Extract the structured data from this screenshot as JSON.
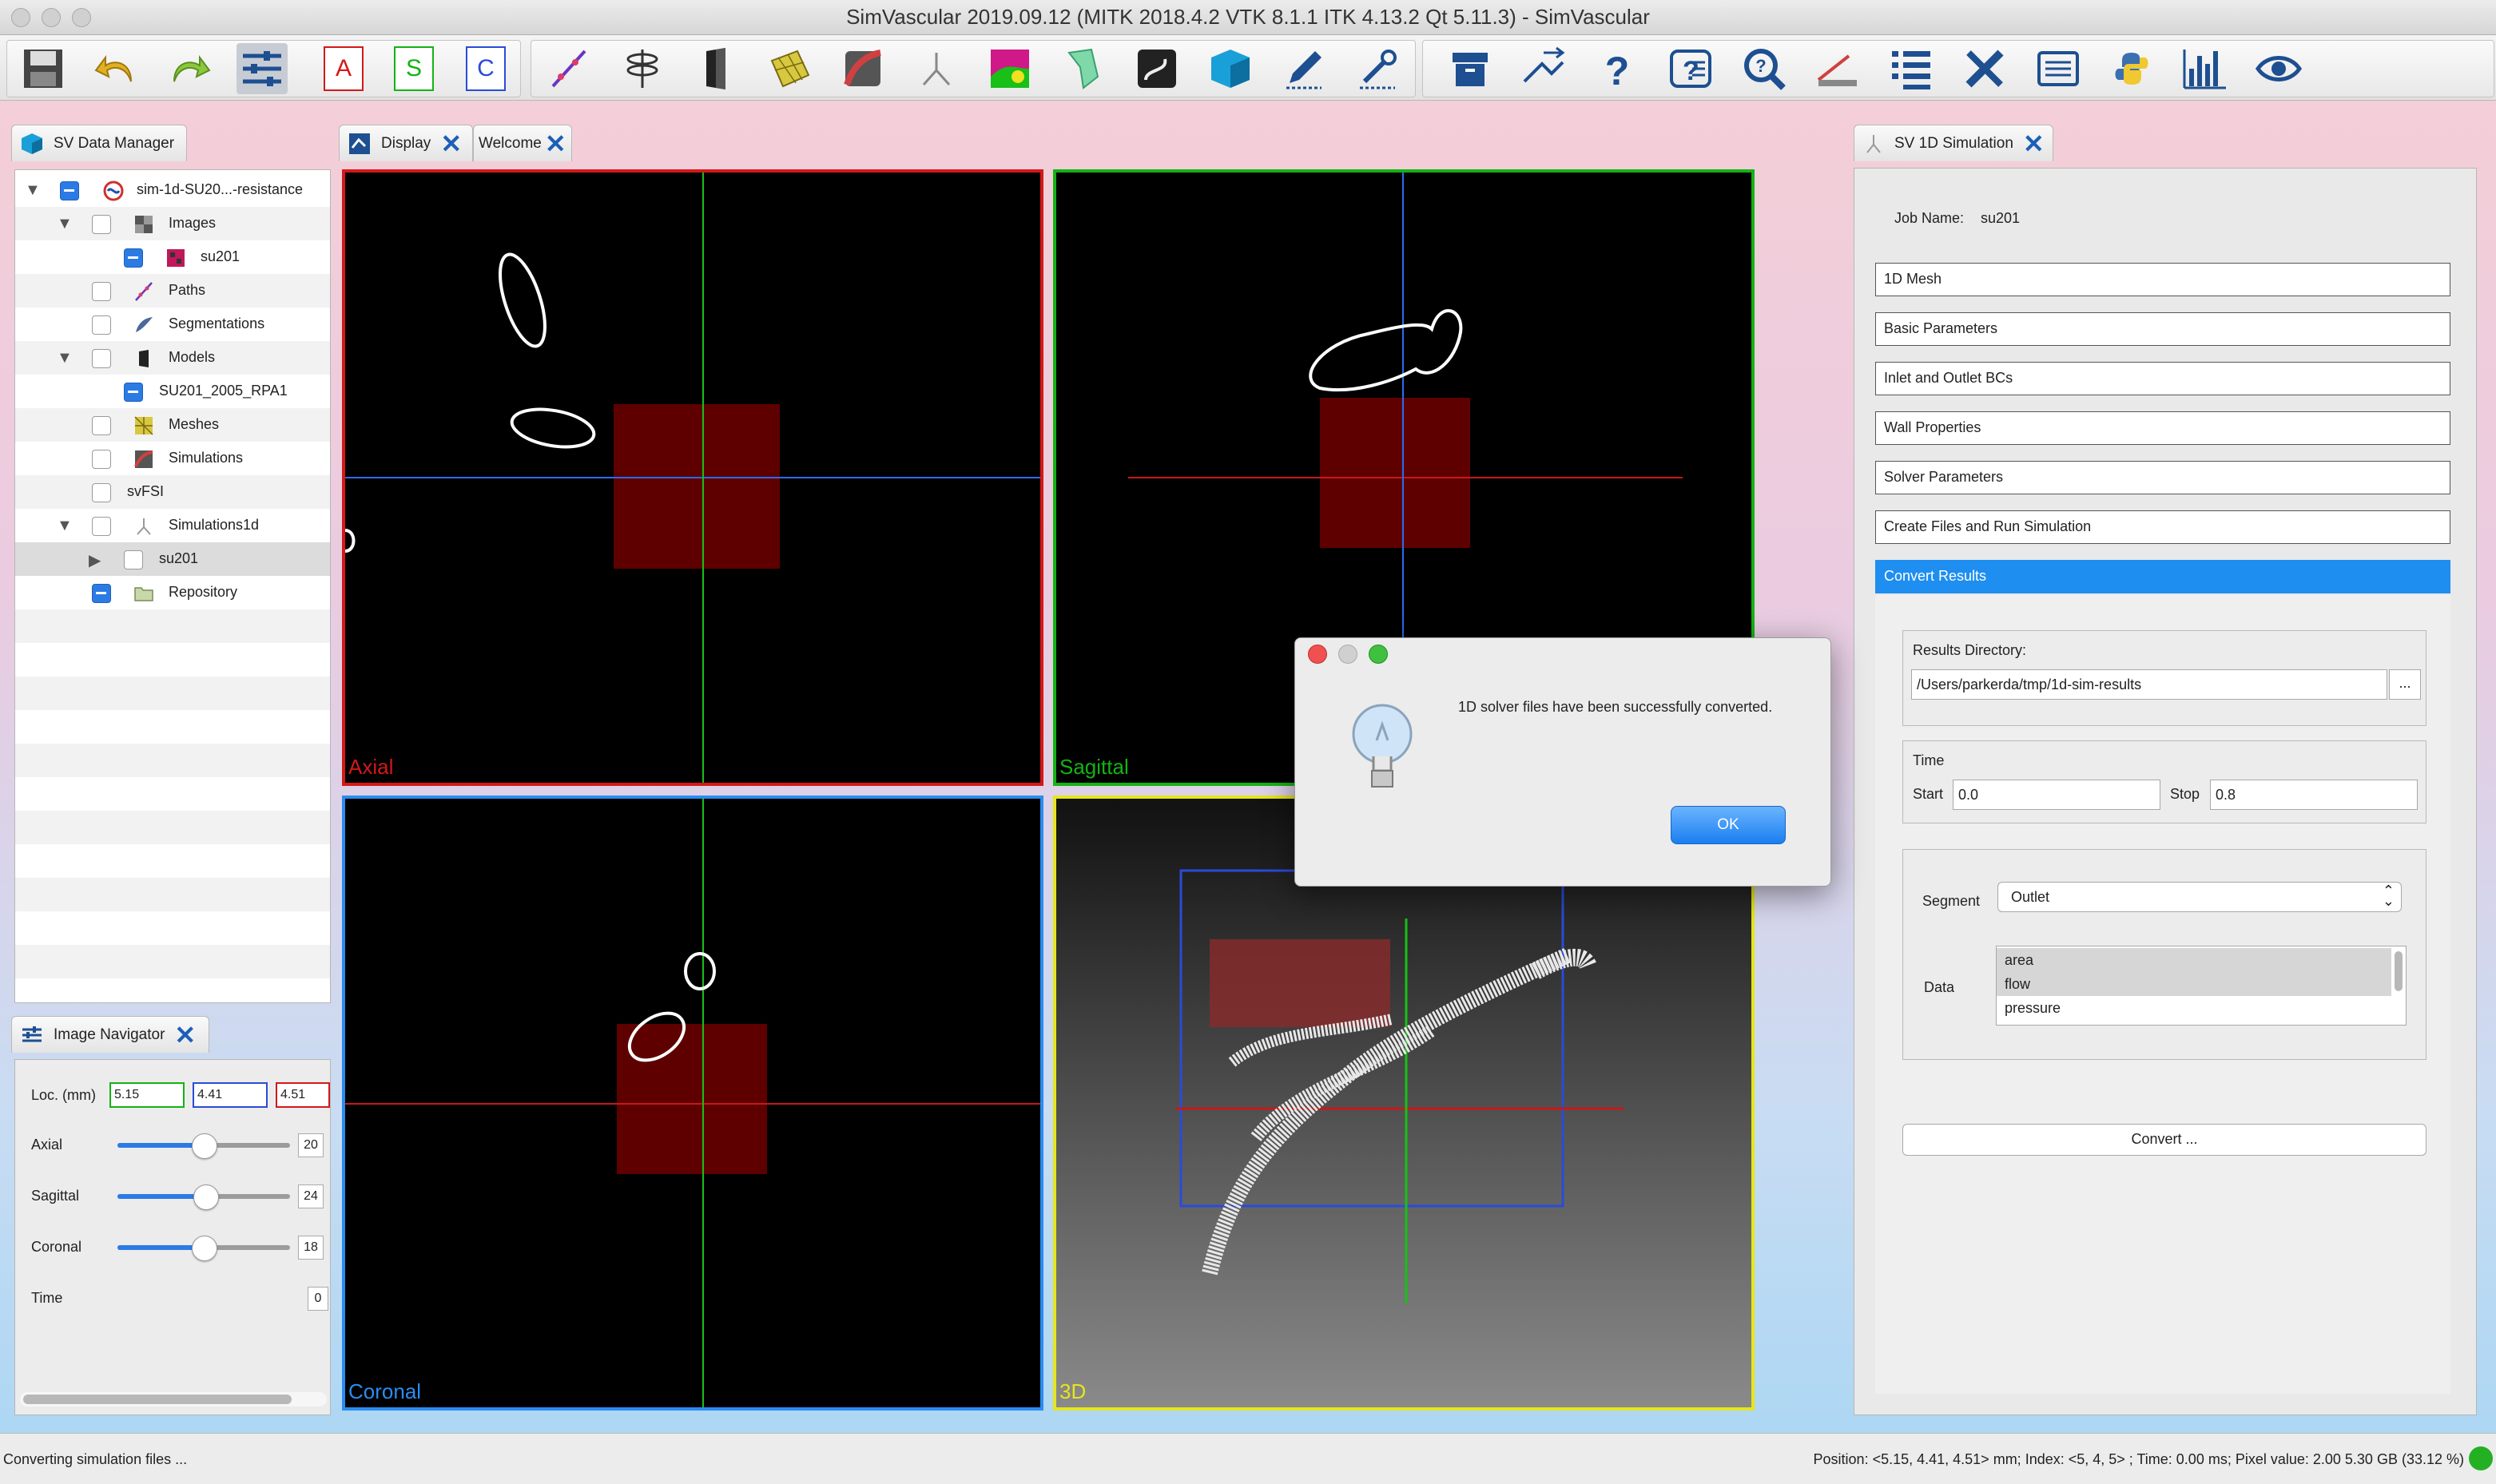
{
  "window": {
    "title": "SimVascular 2019.09.12 (MITK 2018.4.2 VTK 8.1.1 ITK 4.13.2 Qt 5.11.3) - SimVascular"
  },
  "toolbar": {
    "letters": [
      "A",
      "S",
      "C"
    ],
    "icons": [
      "save-icon",
      "undo-icon",
      "redo-icon",
      "settings-sliders-icon",
      "path-icon",
      "segmentation-icon",
      "model-icon",
      "mesh-icon",
      "simulation-icon",
      "1d-sim-icon",
      "image-color-icon",
      "svfsi-icon",
      "path-curve-icon",
      "cube-icon",
      "pen-icon",
      "tools-icon",
      "archive-icon",
      "measure-icon",
      "help-icon",
      "info-icon",
      "search-icon",
      "ruler-icon",
      "list-icon",
      "pencil-ruler-icon",
      "text-lines-icon",
      "python-icon",
      "bar-chart-icon",
      "eye-icon"
    ]
  },
  "data_manager": {
    "tab_label": "SV Data Manager",
    "items": [
      {
        "label": "sim-1d-SU20...-resistance"
      },
      {
        "label": "Images"
      },
      {
        "label": "su201"
      },
      {
        "label": "Paths"
      },
      {
        "label": "Segmentations"
      },
      {
        "label": "Models"
      },
      {
        "label": "SU201_2005_RPA1"
      },
      {
        "label": "Meshes"
      },
      {
        "label": "Simulations"
      },
      {
        "label": "svFSI"
      },
      {
        "label": "Simulations1d"
      },
      {
        "label": "su201"
      },
      {
        "label": "Repository"
      }
    ]
  },
  "center_tabs": {
    "display": "Display",
    "welcome": "Welcome"
  },
  "viewports": {
    "axial": "Axial",
    "sagittal": "Sagittal",
    "coronal": "Coronal",
    "three_d": "3D"
  },
  "image_navigator": {
    "tab_label": "Image Navigator",
    "loc_label": "Loc. (mm)",
    "loc_x": "5.15",
    "loc_y": "4.41",
    "loc_z": "4.51",
    "axial_label": "Axial",
    "axial_value": "20",
    "sagittal_label": "Sagittal",
    "sagittal_value": "24",
    "coronal_label": "Coronal",
    "coronal_value": "18",
    "time_label": "Time",
    "time_value": "0",
    "axial_fraction": 0.5,
    "sagittal_fraction": 0.51,
    "coronal_fraction": 0.5
  },
  "sim_panel": {
    "tab_label": "SV 1D Simulation",
    "job_name_label": "Job Name:",
    "job_name": "su201",
    "sections": [
      "1D Mesh",
      "Basic Parameters",
      "Inlet and Outlet BCs",
      "Wall Properties",
      "Solver Parameters",
      "Create Files and Run Simulation",
      "Convert Results"
    ],
    "results_dir_label": "Results Directory:",
    "results_dir": "/Users/parkerda/tmp/1d-sim-results",
    "browse_label": "...",
    "time_label": "Time",
    "start_label": "Start",
    "start_value": "0.0",
    "stop_label": "Stop",
    "stop_value": "0.8",
    "segment_label": "Segment",
    "segment_value": "Outlet",
    "data_label": "Data",
    "data_items": [
      "area",
      "flow",
      "pressure"
    ],
    "convert_label": "Convert ..."
  },
  "dialog": {
    "message": "1D solver files have been successfully converted.",
    "ok_label": "OK"
  },
  "status": {
    "left": "Converting simulation files ...",
    "right": "Position: <5.15, 4.41, 4.51> mm; Index: <5, 4, 5> ; Time: 0.00 ms; Pixel value: 2.00  5.30 GB (33.12 %)"
  },
  "colors": {
    "axial_border": "#d41818",
    "sagittal_border": "#13b313",
    "coronal_border": "#2a8cf0",
    "three_d_border": "#e6e61a",
    "accent": "#1e8ef0"
  }
}
